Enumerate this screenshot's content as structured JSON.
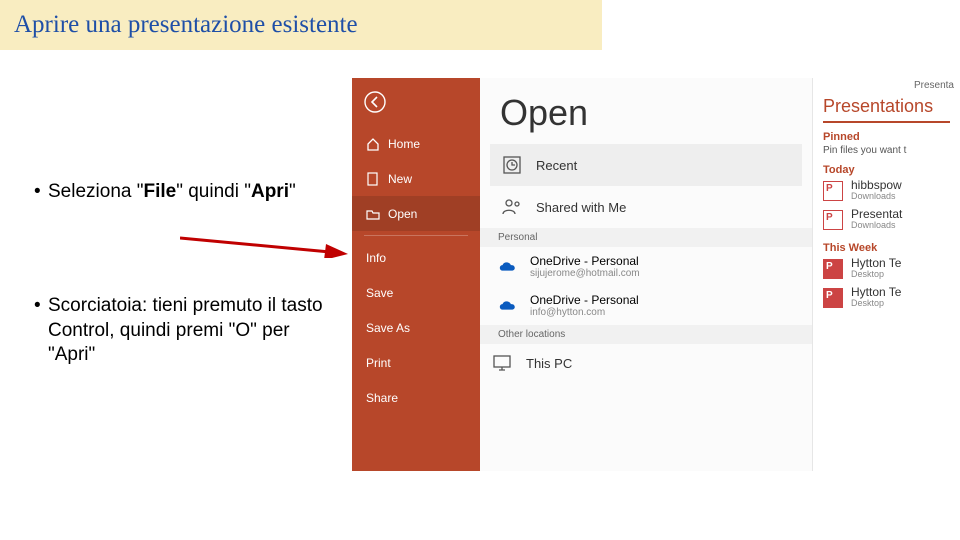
{
  "title": "Aprire una presentazione esistente",
  "bullets": {
    "b1_pre": "Seleziona \"",
    "b1_file": "File",
    "b1_mid": "\" quindi \"",
    "b1_apri": "Apri",
    "b1_post": "\"",
    "b2": "Scorciatoia: tieni premuto il tasto Control, quindi premi \"O\" per \"Apri\""
  },
  "app": {
    "top_right": "Presenta",
    "nav": {
      "home": "Home",
      "new": "New",
      "open": "Open",
      "info": "Info",
      "save": "Save",
      "saveas": "Save As",
      "print": "Print",
      "share": "Share"
    },
    "open_title": "Open",
    "locations": {
      "recent": "Recent",
      "shared": "Shared with Me",
      "personal_lbl": "Personal",
      "od1_title": "OneDrive - Personal",
      "od1_sub": "sijujerome@hotmail.com",
      "od2_title": "OneDrive - Personal",
      "od2_sub": "info@hytton.com",
      "other_lbl": "Other locations",
      "thispc": "This PC"
    },
    "right": {
      "section": "Presentations",
      "pinned": "Pinned",
      "pinned_note": "Pin files you want t",
      "today": "Today",
      "f1": "hibbspow",
      "f1s": "Downloads",
      "f2": "Presentat",
      "f2s": "Downloads",
      "week": "This Week",
      "f3": "Hytton Te",
      "f3s": "Desktop",
      "f4": "Hytton Te",
      "f4s": "Desktop"
    }
  }
}
